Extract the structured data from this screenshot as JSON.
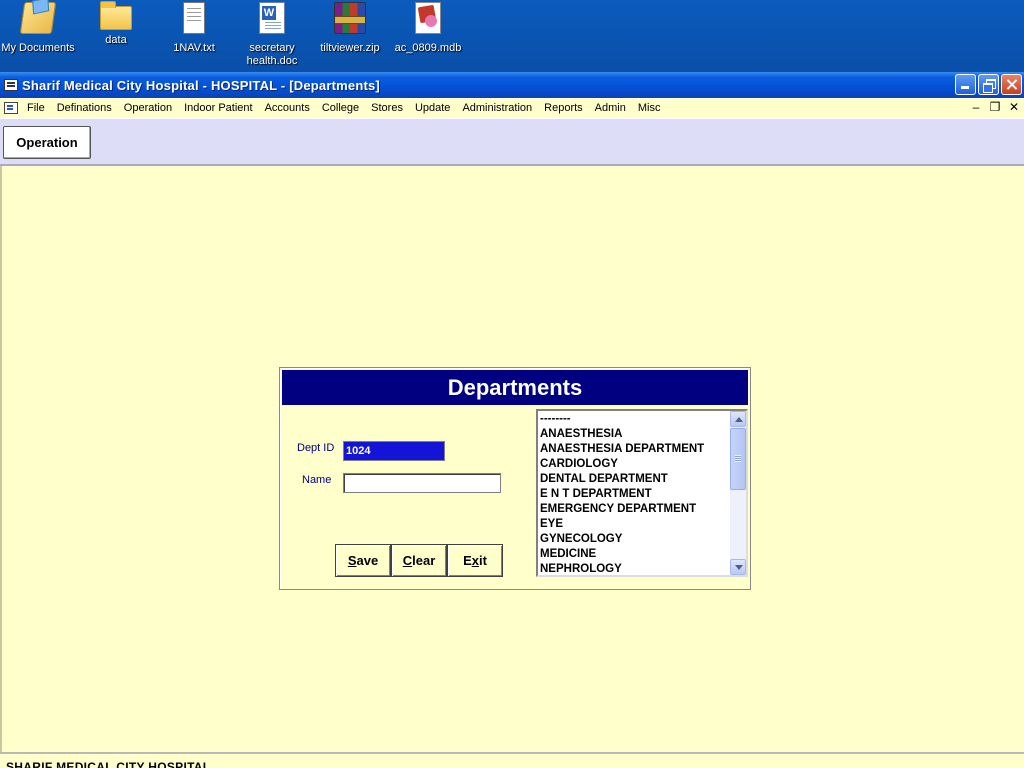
{
  "desktop": {
    "icons": [
      {
        "label": "My Documents",
        "icon": "my-documents-icon"
      },
      {
        "label": "data",
        "icon": "folder-icon"
      },
      {
        "label": "1NAV.txt",
        "icon": "text-file-icon"
      },
      {
        "label": "secretary health.doc",
        "icon": "word-document-icon"
      },
      {
        "label": "tiltviewer.zip",
        "icon": "zip-archive-icon"
      },
      {
        "label": "ac_0809.mdb",
        "icon": "access-database-icon"
      }
    ]
  },
  "window": {
    "title": "Sharif Medical City Hospital - HOSPITAL - [Departments]"
  },
  "menu": {
    "items": [
      "File",
      "Definations",
      "Operation",
      "Indoor Patient",
      "Accounts",
      "College",
      "Stores",
      "Update",
      "Administration",
      "Reports",
      "Admin",
      "Misc"
    ],
    "mdi_minimize": "–",
    "mdi_restore": "❐",
    "mdi_close": "✕"
  },
  "toolbar": {
    "operation_label": "Operation"
  },
  "dialog": {
    "title": "Departments",
    "dept_id_label": "Dept ID",
    "dept_id_value": "1024",
    "name_label": "Name",
    "name_value": "",
    "save_first": "S",
    "save_rest": "ave",
    "clear_first": "C",
    "clear_rest": "lear",
    "exit_first": "E",
    "exit_mid": "x",
    "exit_rest": "it",
    "departments": [
      "--------",
      "ANAESTHESIA",
      "ANAESTHESIA DEPARTMENT",
      "CARDIOLOGY",
      "DENTAL DEPARTMENT",
      "E N T DEPARTMENT",
      "EMERGENCY DEPARTMENT",
      "EYE",
      "GYNECOLOGY",
      "MEDICINE",
      "NEPHROLOGY"
    ]
  },
  "statusbar": {
    "text": "SHARIF MEDICAL CITY HOSPITAL"
  },
  "colors": {
    "client_bg": "#ffffcc",
    "dialog_header": "#000080",
    "dept_id_bg": "#1414d8",
    "toolbar_bg": "#ddddf8"
  }
}
